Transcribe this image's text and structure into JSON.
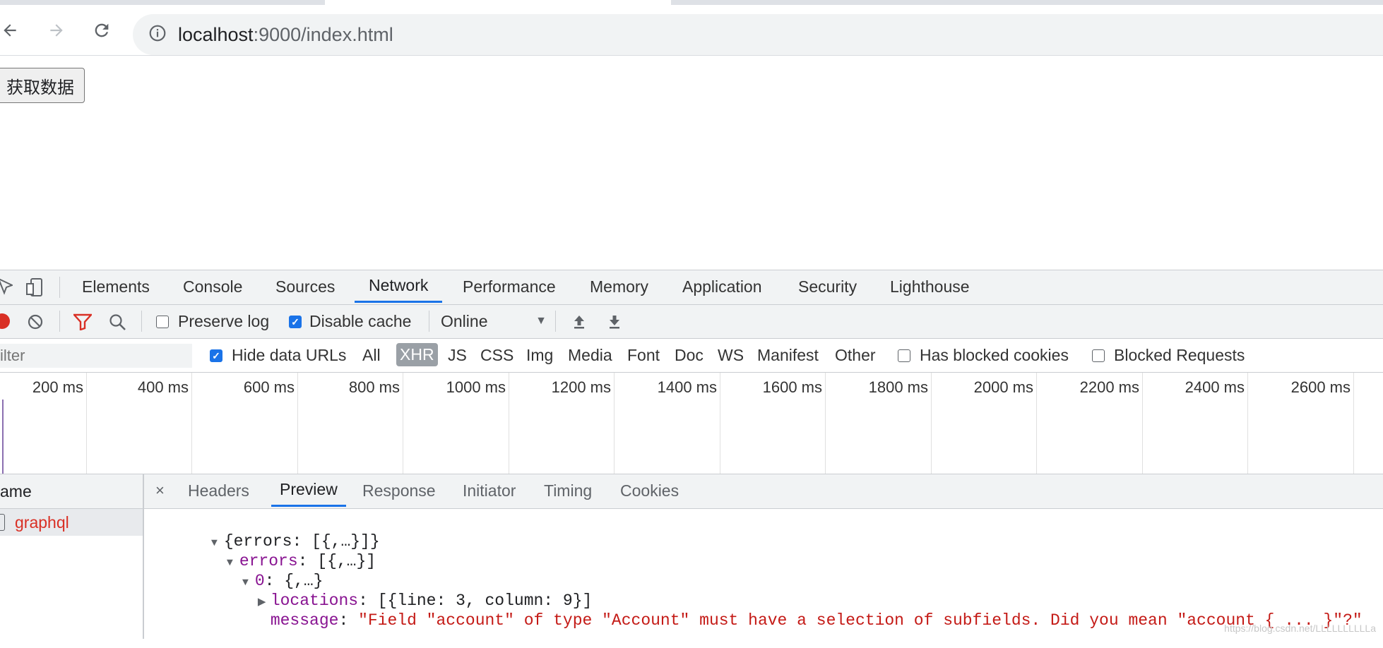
{
  "browser": {
    "url_host": "localhost",
    "url_path": ":9000/index.html"
  },
  "page": {
    "fetch_button": "获取数据"
  },
  "devtools": {
    "tabs": [
      "Elements",
      "Console",
      "Sources",
      "Network",
      "Performance",
      "Memory",
      "Application",
      "Security",
      "Lighthouse"
    ],
    "active_tab": "Network",
    "controls": {
      "preserve_log": "Preserve log",
      "disable_cache": "Disable cache",
      "throttle": "Online"
    },
    "filter": {
      "placeholder": "ilter",
      "hide_data_urls": "Hide data URLs",
      "types": [
        "All",
        "XHR",
        "JS",
        "CSS",
        "Img",
        "Media",
        "Font",
        "Doc",
        "WS",
        "Manifest",
        "Other"
      ],
      "active_type": "XHR",
      "has_blocked_cookies": "Has blocked cookies",
      "blocked_requests": "Blocked Requests"
    },
    "timeline_ticks": [
      "200 ms",
      "400 ms",
      "600 ms",
      "800 ms",
      "1000 ms",
      "1200 ms",
      "1400 ms",
      "1600 ms",
      "1800 ms",
      "2000 ms",
      "2200 ms",
      "2400 ms",
      "2600 ms"
    ],
    "request_list": {
      "header": "ame",
      "rows": [
        "graphql"
      ]
    },
    "detail": {
      "close": "×",
      "tabs": [
        "Headers",
        "Preview",
        "Response",
        "Initiator",
        "Timing",
        "Cookies"
      ],
      "active_tab": "Preview",
      "preview": {
        "root": "{errors: [{,…}]}",
        "errors_key": "errors",
        "errors_val": ": [{,…}]",
        "item_key": "0",
        "item_val": ": {,…}",
        "locations_key": "locations",
        "locations_val": ": [{line: 3, column: 9}]",
        "message_key": "message",
        "message_sep": ": ",
        "message_val": "\"Field \"account\" of type \"Account\" must have a selection of subfields. Did you mean \"account { ... }\"?\""
      }
    }
  },
  "watermark": "https://blog.csdn.net/LLLLLLLLLLa"
}
